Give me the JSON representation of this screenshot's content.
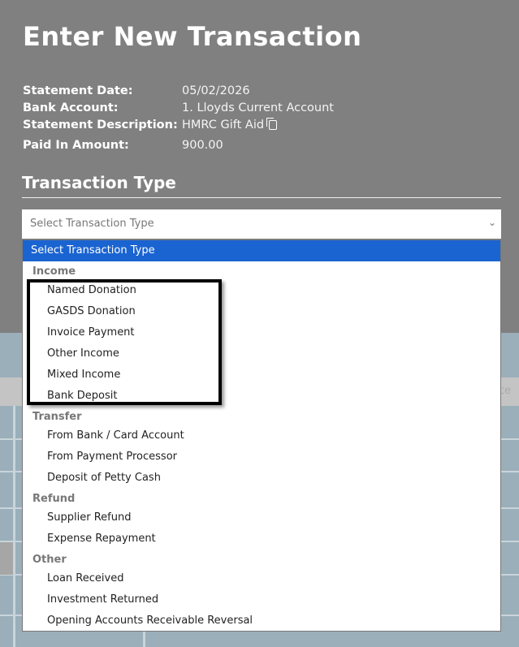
{
  "title": "Enter New Transaction",
  "statement": [
    {
      "label": "Statement Date:",
      "value": "05/02/2026"
    },
    {
      "label": "Bank Account:",
      "value": "1. Lloyds Current Account"
    },
    {
      "label": "Statement Description:",
      "value": "HMRC Gift Aid"
    },
    {
      "label": "Paid In Amount:",
      "value": "900.00"
    }
  ],
  "section_title": "Transaction Type",
  "select": {
    "value": "Select Transaction Type"
  },
  "background_header_fragment": "ce",
  "dropdown": {
    "selected": "Select Transaction Type",
    "groups": [
      {
        "label": "Income",
        "items": [
          "Named Donation",
          "GASDS Donation",
          "Invoice Payment",
          "Other Income",
          "Mixed Income",
          "Bank Deposit"
        ]
      },
      {
        "label": "Transfer",
        "items": [
          "From Bank / Card Account",
          "From Payment Processor",
          "Deposit of Petty Cash"
        ]
      },
      {
        "label": "Refund",
        "items": [
          "Supplier Refund",
          "Expense Repayment"
        ]
      },
      {
        "label": "Other",
        "items": [
          "Loan Received",
          "Investment Returned",
          "Opening Accounts Receivable Reversal"
        ]
      }
    ]
  },
  "colors": {
    "highlight": "#1a64d2",
    "header_bg": "#808080",
    "page_bg": "#9aafba"
  }
}
